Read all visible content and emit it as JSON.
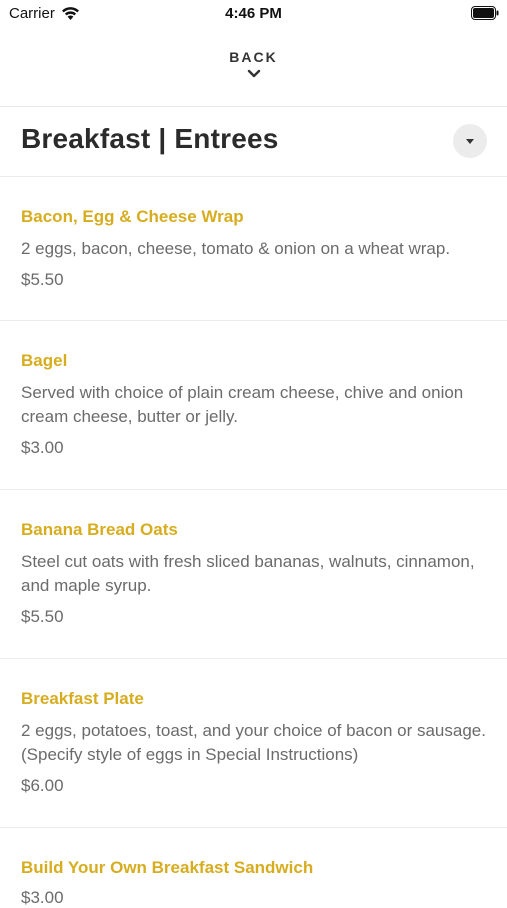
{
  "status_bar": {
    "carrier": "Carrier",
    "time": "4:46 PM",
    "wifi_icon": "wifi-icon",
    "battery_icon": "battery-full-icon"
  },
  "nav": {
    "back_label": "BACK",
    "back_icon": "chevron-down-icon"
  },
  "header": {
    "title": "Breakfast | Entrees",
    "dropdown_icon": "caret-down-icon"
  },
  "colors": {
    "accent": "#d7ad1f",
    "text_muted": "#6b6b6b",
    "title": "#2b2b2b"
  },
  "menu": {
    "items": [
      {
        "name": "Bacon, Egg & Cheese Wrap",
        "description": "2 eggs, bacon, cheese, tomato & onion on a wheat wrap.",
        "price": "$5.50"
      },
      {
        "name": "Bagel",
        "description": "Served with choice of plain cream cheese, chive and onion cream cheese, butter or jelly.",
        "price": "$3.00"
      },
      {
        "name": "Banana Bread Oats",
        "description": "Steel cut oats with fresh sliced bananas, walnuts, cinnamon, and maple syrup.",
        "price": "$5.50"
      },
      {
        "name": "Breakfast Plate",
        "description": "2 eggs, potatoes, toast, and your choice of bacon or sausage. (Specify style of eggs in Special Instructions)",
        "price": "$6.00"
      },
      {
        "name": "Build Your Own Breakfast Sandwich",
        "description": "",
        "price": "$3.00"
      }
    ]
  }
}
